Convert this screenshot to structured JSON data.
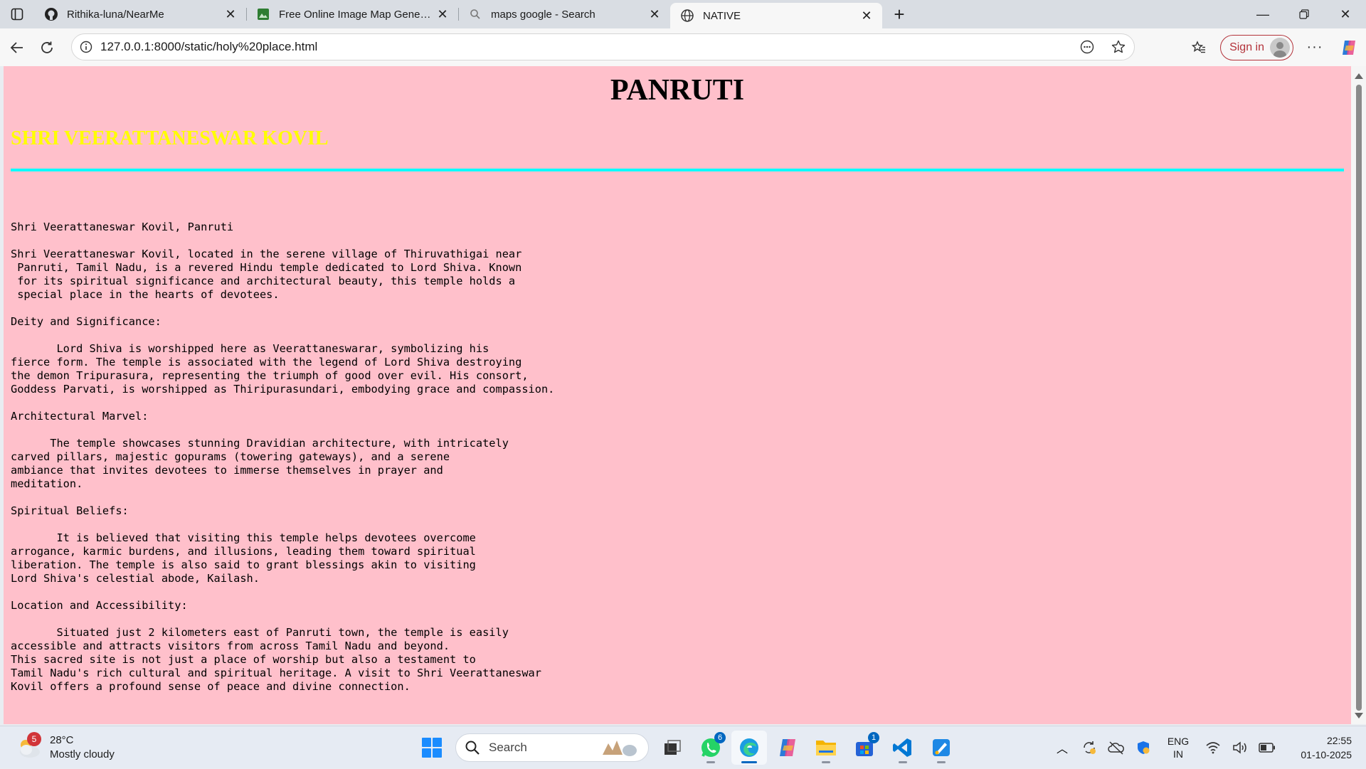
{
  "browser": {
    "tabs": [
      {
        "title": "Rithika-luna/NearMe",
        "icon": "github-icon"
      },
      {
        "title": "Free Online Image Map Generator",
        "icon": "image-map-icon"
      },
      {
        "title": "maps google - Search",
        "icon": "search-icon"
      },
      {
        "title": "NATIVE",
        "icon": "globe-icon",
        "active": true
      }
    ],
    "url": "127.0.0.1:8000/static/holy%20place.html",
    "signin_label": "Sign in"
  },
  "page": {
    "title": "PANRUTI",
    "subtitle": "SHRI VEERATTANESWAR KOVIL",
    "body_text": "\nShri Veerattaneswar Kovil, Panruti\n\nShri Veerattaneswar Kovil, located in the serene village of Thiruvathigai near\n Panruti, Tamil Nadu, is a revered Hindu temple dedicated to Lord Shiva. Known\n for its spiritual significance and architectural beauty, this temple holds a\n special place in the hearts of devotees.\n\nDeity and Significance:\n\n       Lord Shiva is worshipped here as Veerattaneswarar, symbolizing his\nfierce form. The temple is associated with the legend of Lord Shiva destroying\nthe demon Tripurasura, representing the triumph of good over evil. His consort,\nGoddess Parvati, is worshipped as Thiripurasundari, embodying grace and compassion.\n\nArchitectural Marvel:\n\n      The temple showcases stunning Dravidian architecture, with intricately\ncarved pillars, majestic gopurams (towering gateways), and a serene\nambiance that invites devotees to immerse themselves in prayer and\nmeditation.\n\nSpiritual Beliefs:\n\n       It is believed that visiting this temple helps devotees overcome\narrogance, karmic burdens, and illusions, leading them toward spiritual\nliberation. The temple is also said to grant blessings akin to visiting\nLord Shiva's celestial abode, Kailash.\n\nLocation and Accessibility:\n\n       Situated just 2 kilometers east of Panruti town, the temple is easily\naccessible and attracts visitors from across Tamil Nadu and beyond.\nThis sacred site is not just a place of worship but also a testament to\nTamil Nadu's rich cultural and spiritual heritage. A visit to Shri Veerattaneswar\nKovil offers a profound sense of peace and divine connection.",
    "colors": {
      "background": "#ffc0cb",
      "subtitle": "#ffff00",
      "rule": "#00ffff"
    }
  },
  "taskbar": {
    "weather": {
      "temp": "28°C",
      "condition": "Mostly cloudy",
      "badge": "5"
    },
    "search_label": "Search",
    "whatsapp_count": "6",
    "store_count": "1",
    "lang": {
      "line1": "ENG",
      "line2": "IN"
    },
    "clock": {
      "time": "22:55",
      "date": "01-10-2025"
    }
  }
}
